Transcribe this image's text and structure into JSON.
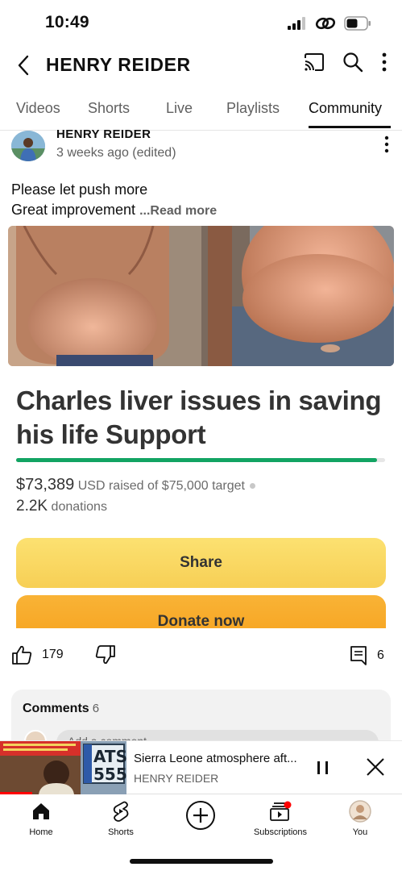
{
  "status_bar": {
    "time": "10:49"
  },
  "header": {
    "title": "HENRY REIDER"
  },
  "tabs": [
    {
      "label": "Videos"
    },
    {
      "label": "Shorts"
    },
    {
      "label": "Live"
    },
    {
      "label": "Playlists"
    },
    {
      "label": "Community",
      "active": true
    }
  ],
  "post": {
    "author": "HENRY REIDER",
    "time": "3 weeks ago (edited)",
    "text_line1": "Please let push more",
    "text_line2": "Great improvement",
    "read_more": "...Read more"
  },
  "fundraiser": {
    "title": "Charles liver issues in saving his life Support",
    "raised_amount": "$73,389",
    "raised_text": "USD raised of $75,000 target",
    "progress_fraction": 0.9785,
    "donations_count": "2.2K",
    "donations_label": "donations",
    "share_label": "Share",
    "donate_label": "Donate now",
    "progress_color": "#12a463"
  },
  "engagement": {
    "likes": "179",
    "comments": "6"
  },
  "comments": {
    "label": "Comments",
    "count": "6",
    "placeholder": "Add a comment..."
  },
  "mini_player": {
    "title": "Sierra Leone atmosphere aft...",
    "channel": "HENRY REIDER",
    "thumb_text": "ATS 555"
  },
  "bottom_nav": [
    {
      "label": "Home",
      "icon": "home-icon"
    },
    {
      "label": "Shorts",
      "icon": "shorts-icon"
    },
    {
      "label": "",
      "icon": "create-icon"
    },
    {
      "label": "Subscriptions",
      "icon": "subscriptions-icon"
    },
    {
      "label": "You",
      "icon": "you-avatar-icon"
    }
  ]
}
